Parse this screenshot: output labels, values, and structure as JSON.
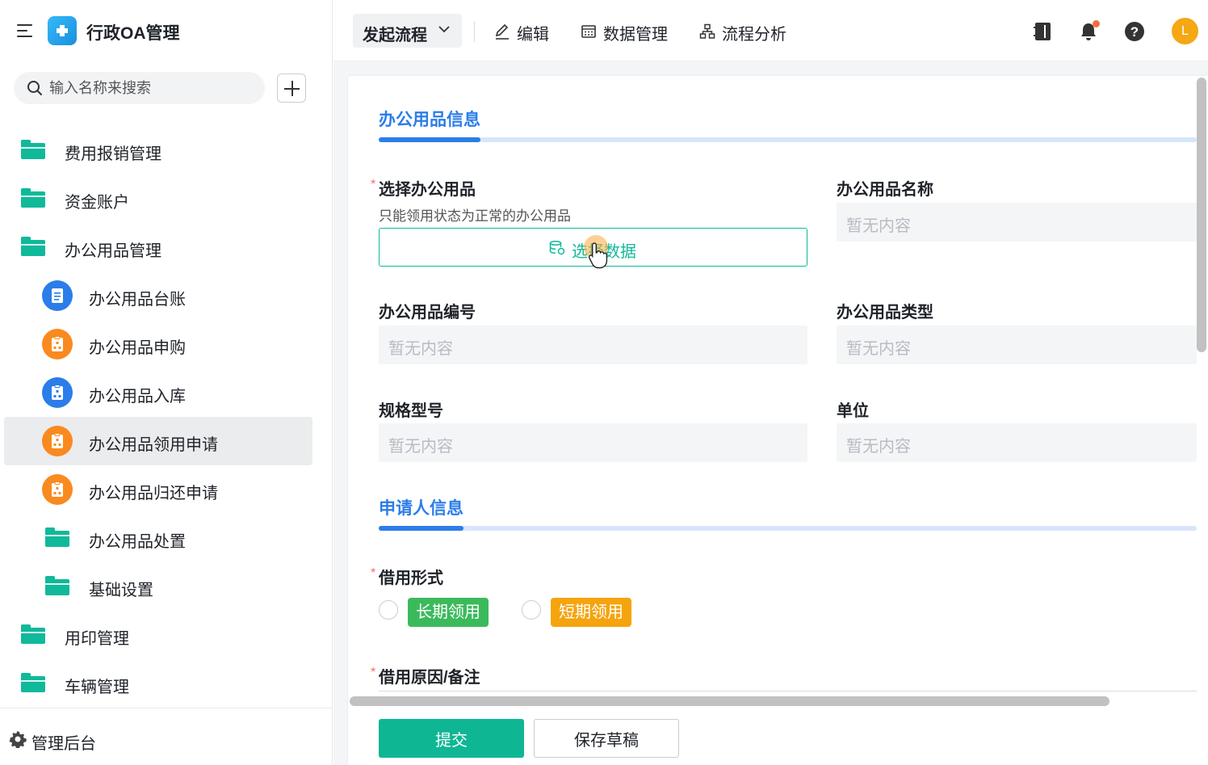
{
  "app": {
    "title": "行政OA管理"
  },
  "search": {
    "placeholder": "输入名称来搜索"
  },
  "sidebar": {
    "items": [
      {
        "label": "费用报销管理"
      },
      {
        "label": "资金账户"
      },
      {
        "label": "办公用品管理"
      },
      {
        "label": "办公用品台账"
      },
      {
        "label": "办公用品申购"
      },
      {
        "label": "办公用品入库"
      },
      {
        "label": "办公用品领用申请"
      },
      {
        "label": "办公用品归还申请"
      },
      {
        "label": "办公用品处置"
      },
      {
        "label": "基础设置"
      },
      {
        "label": "用印管理"
      },
      {
        "label": "车辆管理"
      }
    ],
    "footer": "管理后台"
  },
  "toolbar": {
    "start_process": "发起流程",
    "edit": "编辑",
    "data_manage": "数据管理",
    "process_analysis": "流程分析",
    "avatar_initial": "L"
  },
  "form": {
    "section1_title": "办公用品信息",
    "section2_title": "申请人信息",
    "required_mark": "*",
    "select_supply_label": "选择办公用品",
    "select_supply_hint": "只能领用状态为正常的办公用品",
    "select_data_btn": "选择数据",
    "supply_name_label": "办公用品名称",
    "supply_code_label": "办公用品编号",
    "supply_type_label": "办公用品类型",
    "spec_label": "规格型号",
    "unit_label": "单位",
    "empty_text": "暂无内容",
    "borrow_form_label": "借用形式",
    "option_long": "长期领用",
    "option_short": "短期领用",
    "reason_label": "借用原因/备注"
  },
  "actions": {
    "submit": "提交",
    "save_draft": "保存草稿"
  },
  "colors": {
    "accent": "#2b7de9",
    "primary": "#0fb694",
    "long_tag": "#3bba5c",
    "short_tag": "#f5a40e"
  }
}
